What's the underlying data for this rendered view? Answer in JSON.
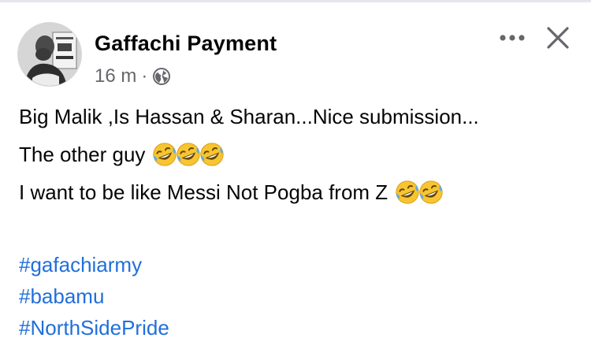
{
  "post": {
    "author": "Gaffachi Payment",
    "time": "16 m",
    "separator": "·",
    "privacy_icon": "globe-icon",
    "more_icon": "more-options-icon",
    "close_icon": "close-icon",
    "lines": [
      "Big Malik ,Is Hassan  & Sharan...Nice submission...",
      "The other guy",
      "I want to be like Messi Not Pogba from Z"
    ],
    "line_emoji_counts": [
      0,
      3,
      2
    ],
    "emoji_name": "rolling-on-the-floor-laughing-emoji",
    "hashtags": [
      "#gafachiarmy",
      "#babamu",
      "#NorthSidePride"
    ],
    "colors": {
      "hashtag": "#216fdb",
      "meta": "#65676b",
      "text": "#050505"
    }
  }
}
